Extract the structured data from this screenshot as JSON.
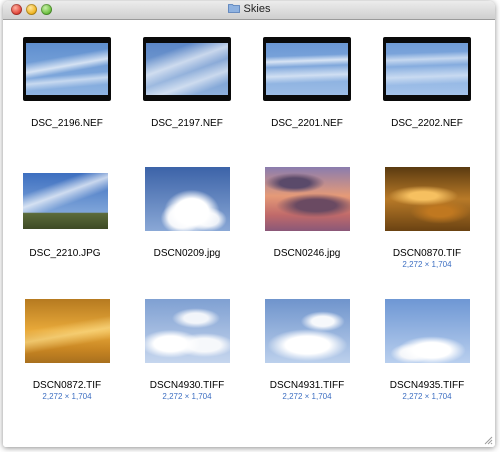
{
  "window": {
    "title": "Skies"
  },
  "colors": {
    "dimensions_text": "#3d6fc2",
    "titlebar_top": "#ececec",
    "titlebar_bottom": "#cfcfcf"
  },
  "files": [
    {
      "name": "DSC_2196.NEF",
      "dims": ""
    },
    {
      "name": "DSC_2197.NEF",
      "dims": ""
    },
    {
      "name": "DSC_2201.NEF",
      "dims": ""
    },
    {
      "name": "DSC_2202.NEF",
      "dims": ""
    },
    {
      "name": "DSC_2210.JPG",
      "dims": ""
    },
    {
      "name": "DSCN0209.jpg",
      "dims": ""
    },
    {
      "name": "DSCN0246.jpg",
      "dims": ""
    },
    {
      "name": "DSCN0870.TIF",
      "dims": "2,272 × 1,704"
    },
    {
      "name": "DSCN0872.TIF",
      "dims": "2,272 × 1,704"
    },
    {
      "name": "DSCN4930.TIFF",
      "dims": "2,272 × 1,704"
    },
    {
      "name": "DSCN4931.TIFF",
      "dims": "2,272 × 1,704"
    },
    {
      "name": "DSCN4935.TIFF",
      "dims": "2,272 × 1,704"
    }
  ]
}
